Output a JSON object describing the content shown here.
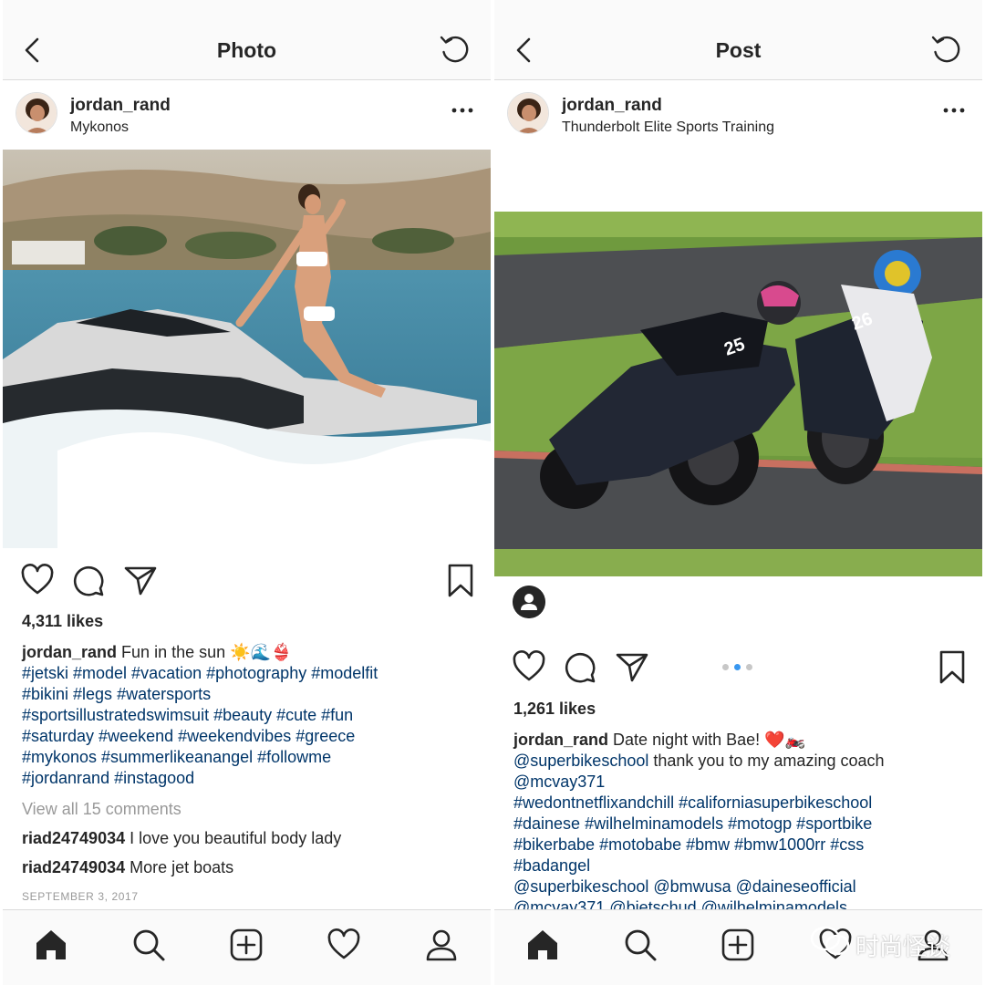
{
  "left": {
    "topbar": {
      "title": "Photo"
    },
    "post": {
      "username": "jordan_rand",
      "location": "Mykonos",
      "likes": "4,311 likes",
      "caption_text": "Fun in the sun ☀️🌊👙",
      "hashtags": [
        "#jetski #model #vacation #photography #modelfit",
        "#bikini #legs #watersports",
        "#sportsillustratedswimsuit #beauty #cute #fun",
        "#saturday #weekend #weekendvibes #greece",
        "#mykonos #summerlikeanangel #followme",
        "#jordanrand #instagood"
      ],
      "view_all": "View all 15 comments",
      "comments": [
        {
          "user": "riad24749034",
          "text": "I love you beautiful body lady"
        },
        {
          "user": "riad24749034",
          "text": "More jet boats"
        }
      ],
      "date": "SEPTEMBER 3, 2017"
    }
  },
  "right": {
    "topbar": {
      "title": "Post"
    },
    "post": {
      "username": "jordan_rand",
      "location": "Thunderbolt Elite Sports Training",
      "likes": "1,261 likes",
      "caption_text": "Date night with Bae! ❤️🏍️",
      "mentions_1": "@superbikeschool",
      "mentions_1_rest": " thank you to my amazing coach",
      "mentions_2": "@mcvay371",
      "hashtags": [
        "#wedontnetflixandchill #californiasuperbikeschool",
        "#dainese #wilhelminamodels #motogp #sportbike",
        "#bikerbabe #motobabe #bmw #bmw1000rr #css",
        "#badangel"
      ],
      "mentions_3": "@superbikeschool @bmwusa @daineseofficial",
      "mentions_4": "@mcvay371 @bietschud @wilhelminamodels",
      "bike_numbers": [
        "25",
        "26"
      ],
      "carousel_index": 2,
      "carousel_count": 3
    }
  },
  "watermark": {
    "text": "时尚怪谈"
  },
  "colors": {
    "hashtag": "#003569",
    "muted": "#999999",
    "accent_dot": "#3897f0"
  }
}
